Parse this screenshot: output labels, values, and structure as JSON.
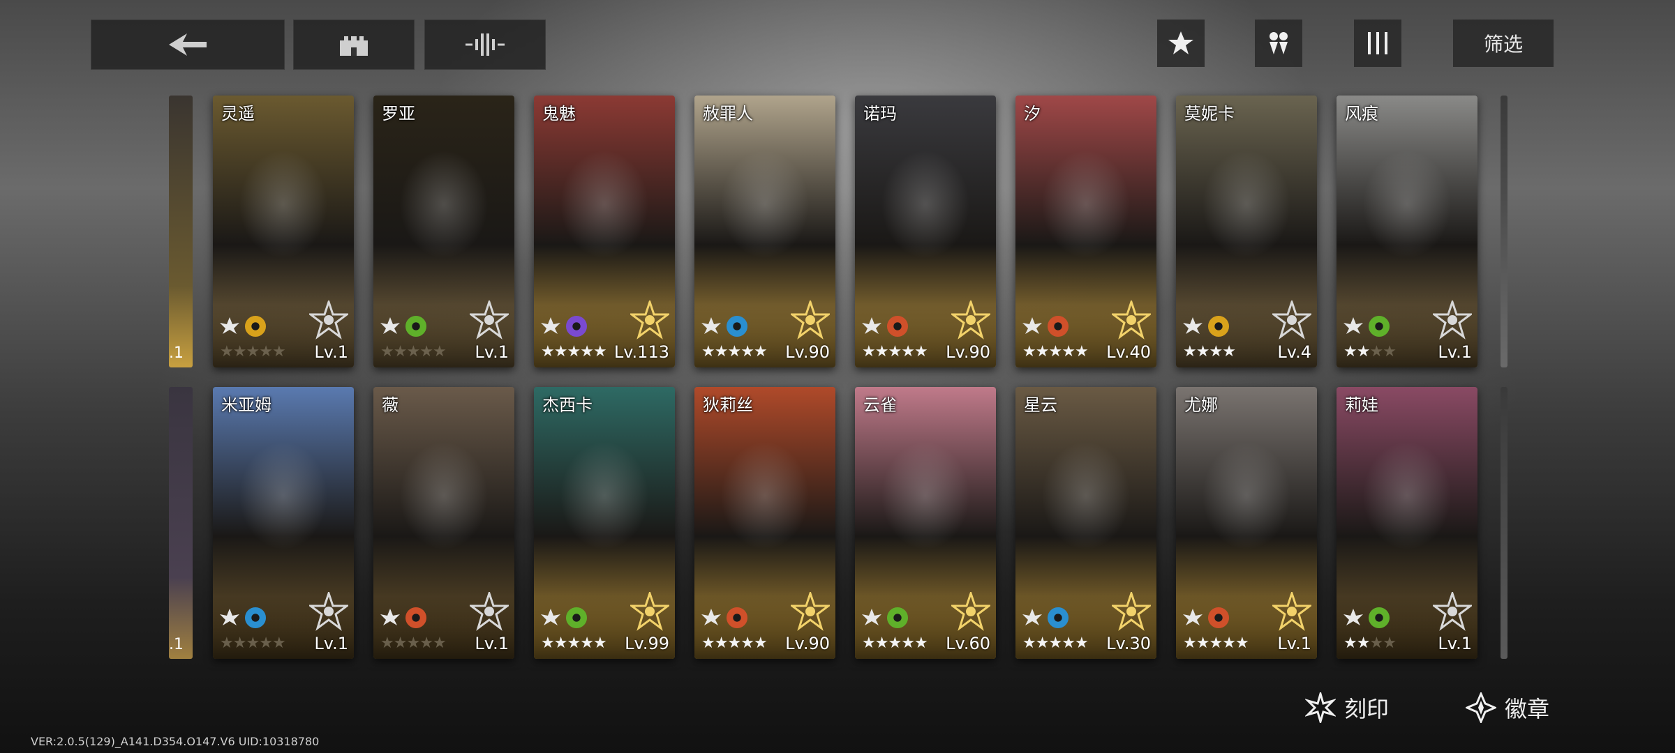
{
  "filter_label": "筛选",
  "version_text": "VER:2.0.5(129)_A141.D354.O147.V6    UID:10318780",
  "bottom_links": {
    "engrave": "刻印",
    "badge": "徽章"
  },
  "icons": {
    "back": "back-arrow-icon",
    "base": "castle-icon",
    "wave": "soundwave-icon",
    "favorite": "star-icon",
    "group": "team-icon",
    "columns": "columns-icon"
  },
  "row1": [
    {
      "name": "灵遥",
      "stars": "★★★★★",
      "filled": 0,
      "level": "Lv.1",
      "element": "#d9a21b",
      "art": "#6b5a30"
    },
    {
      "name": "罗亚",
      "stars": "★★★★★",
      "filled": 0,
      "level": "Lv.1",
      "element": "#5fb02a",
      "art": "#2a2418"
    },
    {
      "name": "鬼魅",
      "stars": "★★★★★",
      "filled": 5,
      "level": "Lv.113",
      "element": "#7a4ad0",
      "art": "#8c3a34"
    },
    {
      "name": "赦罪人",
      "stars": "★★★★★",
      "filled": 5,
      "level": "Lv.90",
      "element": "#2a8fd0",
      "art": "#b0a48c"
    },
    {
      "name": "诺玛",
      "stars": "★★★★★",
      "filled": 5,
      "level": "Lv.90",
      "element": "#d0502a",
      "art": "#3a3a3e"
    },
    {
      "name": "汐",
      "stars": "★★★★★",
      "filled": 5,
      "level": "Lv.40",
      "element": "#d0502a",
      "art": "#a04848"
    },
    {
      "name": "莫妮卡",
      "stars": "★★★★",
      "filled": 4,
      "level": "Lv.4",
      "element": "#d9a21b",
      "art": "#6a6450"
    },
    {
      "name": "风痕",
      "stars": "★★★★",
      "filled": 2,
      "level": "Lv.1",
      "element": "#5fb02a",
      "art": "#8a8a88"
    }
  ],
  "row2": [
    {
      "name": "米亚姆",
      "stars": "★★★★★",
      "filled": 0,
      "level": "Lv.1",
      "element": "#2a8fd0",
      "art": "#5a7ab0"
    },
    {
      "name": "薇",
      "stars": "★★★★★",
      "filled": 0,
      "level": "Lv.1",
      "element": "#d0502a",
      "art": "#6a5a4a"
    },
    {
      "name": "杰西卡",
      "stars": "★★★★★",
      "filled": 5,
      "level": "Lv.99",
      "element": "#5fb02a",
      "art": "#2e6a64"
    },
    {
      "name": "狄莉丝",
      "stars": "★★★★★",
      "filled": 5,
      "level": "Lv.90",
      "element": "#d0502a",
      "art": "#b04a2a"
    },
    {
      "name": "云雀",
      "stars": "★★★★★",
      "filled": 5,
      "level": "Lv.60",
      "element": "#5fb02a",
      "art": "#c07a8a"
    },
    {
      "name": "星云",
      "stars": "★★★★★",
      "filled": 5,
      "level": "Lv.30",
      "element": "#2a8fd0",
      "art": "#6a5a44"
    },
    {
      "name": "尤娜",
      "stars": "★★★★★",
      "filled": 5,
      "level": "Lv.1",
      "element": "#d0502a",
      "art": "#7a7470"
    },
    {
      "name": "莉娃",
      "stars": "★★★★",
      "filled": 2,
      "level": "Lv.1",
      "element": "#5fb02a",
      "art": "#8a4a64"
    }
  ]
}
